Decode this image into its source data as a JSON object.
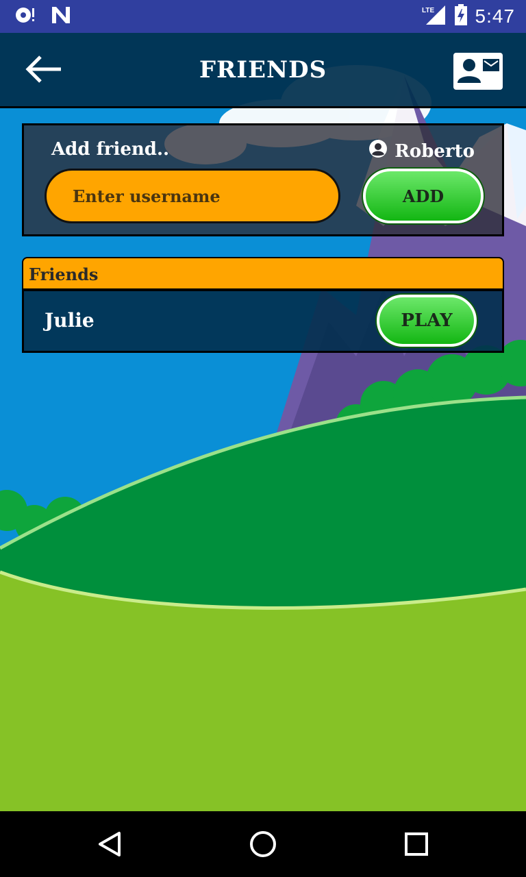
{
  "status_bar": {
    "time": "5:47",
    "network": "LTE",
    "icons": [
      "sync-icon",
      "n-logo-icon",
      "lte-signal-icon",
      "battery-charging-icon"
    ]
  },
  "app_bar": {
    "title": "FRIENDS",
    "back_icon": "arrow-left-icon",
    "contact_icon": "contact-mail-icon"
  },
  "add_friend": {
    "label": "Add friend..",
    "current_user": "Roberto",
    "user_icon": "account-circle-icon",
    "input": {
      "value": "",
      "placeholder": "Enter username"
    },
    "add_button": "ADD"
  },
  "friends_list": {
    "header": "Friends",
    "rows": [
      {
        "name": "Julie",
        "action": "PLAY"
      }
    ]
  },
  "nav_bar": {
    "icons": [
      "back-triangle-icon",
      "home-circle-icon",
      "recents-square-icon"
    ]
  },
  "colors": {
    "status_bar": "#303f9f",
    "app_bar": "#012f4e",
    "accent_orange": "#ffa500",
    "button_green": "#13b613",
    "sky": "#0a8fd6",
    "grass_light": "#86c226",
    "grass_dark": "#008f3c"
  }
}
